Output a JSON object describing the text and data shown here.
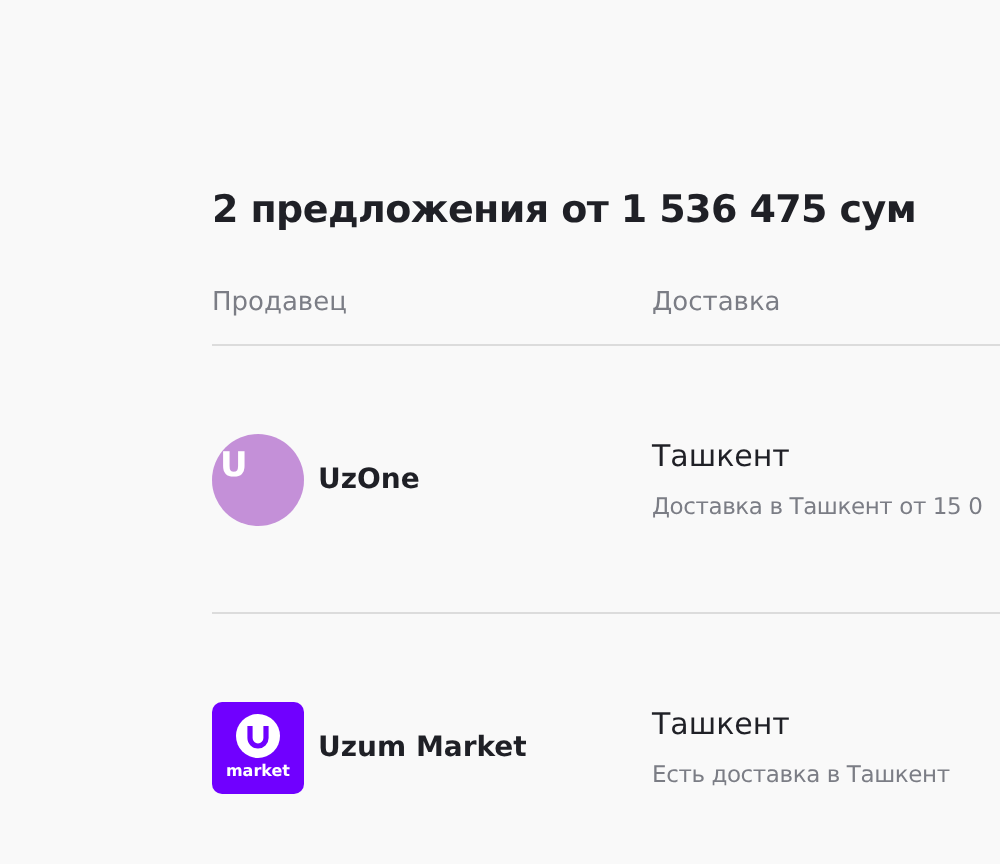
{
  "title": "2 предложения от 1 536 475 сум",
  "columns": [
    "Продавец",
    "Доставка"
  ],
  "offers": [
    {
      "seller": "UzOne",
      "logo": {
        "kind": "letter",
        "text": "U"
      },
      "city": "Ташкент",
      "delivery": "Доставка в Ташкент от 15 0"
    },
    {
      "seller": "Uzum Market",
      "logo": {
        "kind": "brand",
        "text": "market"
      },
      "city": "Ташкент",
      "delivery": "Есть доставка в Ташкент"
    }
  ]
}
